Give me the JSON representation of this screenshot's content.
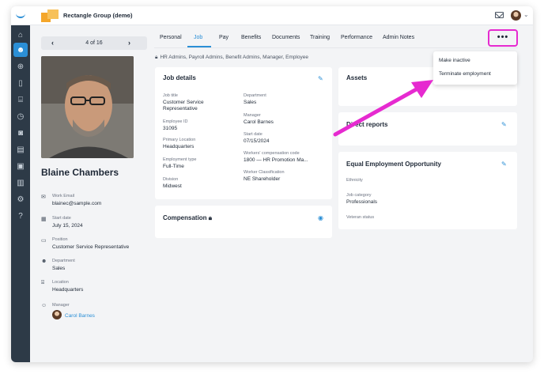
{
  "topbar": {
    "company_name": "Rectangle Group (demo)"
  },
  "sidebar": {
    "items": [
      "home-icon",
      "people-icon",
      "search-user-icon",
      "clipboard-icon",
      "building-icon",
      "clock-icon",
      "camera-icon",
      "books-icon",
      "id-card-icon",
      "chart-icon",
      "settings-icon",
      "help-icon"
    ],
    "active_index": 1
  },
  "pager": {
    "count": "4 of 16",
    "prev": "‹",
    "next": "›"
  },
  "employee": {
    "name": "Blaine Chambers",
    "fields": [
      {
        "label": "Work Email",
        "value": "blainec@sample.com",
        "icon": "mail-icon"
      },
      {
        "label": "Start date",
        "value": "July 15, 2024",
        "icon": "calendar-icon"
      },
      {
        "label": "Position",
        "value": "Customer Service Representative",
        "icon": "briefcase-icon"
      },
      {
        "label": "Department",
        "value": "Sales",
        "icon": "people-icon"
      },
      {
        "label": "Location",
        "value": "Headquarters",
        "icon": "building-icon"
      },
      {
        "label": "Manager",
        "value": "Carol Barnes",
        "icon": "manager-icon"
      }
    ]
  },
  "tabs": [
    "Personal",
    "Job",
    "Pay",
    "Benefits",
    "Documents",
    "Training",
    "Performance",
    "Admin Notes"
  ],
  "active_tab": "Job",
  "more_button": "•••",
  "access_note": "HR Admins, Payroll Admins, Benefit Admins, Manager, Employee",
  "job_details": {
    "title": "Job details",
    "left": [
      {
        "label": "Job title",
        "value": "Customer Service Representative"
      },
      {
        "label": "Employee ID",
        "value": "31095"
      },
      {
        "label": "Primary Location",
        "value": "Headquarters"
      },
      {
        "label": "Employment type",
        "value": "Full-Time"
      },
      {
        "label": "Division",
        "value": "Midwest"
      }
    ],
    "right": [
      {
        "label": "Department",
        "value": "Sales"
      },
      {
        "label": "Manager",
        "value": "Carol Barnes"
      },
      {
        "label": "Start date",
        "value": "07/15/2024"
      },
      {
        "label": "Workers' compensation code",
        "value": "1800 — HR Promotion Ma..."
      },
      {
        "label": "Worker Classification",
        "value": "NE Shareholder"
      }
    ]
  },
  "compensation": {
    "title": "Compensation"
  },
  "assets": {
    "title": "Assets"
  },
  "direct_reports": {
    "title": "Direct reports"
  },
  "eeo": {
    "title": "Equal Employment Opportunity",
    "fields": [
      {
        "label": "Ethnicity",
        "value": ""
      },
      {
        "label": "Job category",
        "value": "Professionals"
      },
      {
        "label": "Veteran status",
        "value": ""
      }
    ]
  },
  "menu": {
    "items": [
      "Make inactive",
      "Terminate employment"
    ]
  },
  "colors": {
    "accent": "#2b8fd6",
    "annotation": "#e62ad0",
    "sidebar": "#2d3a47"
  }
}
